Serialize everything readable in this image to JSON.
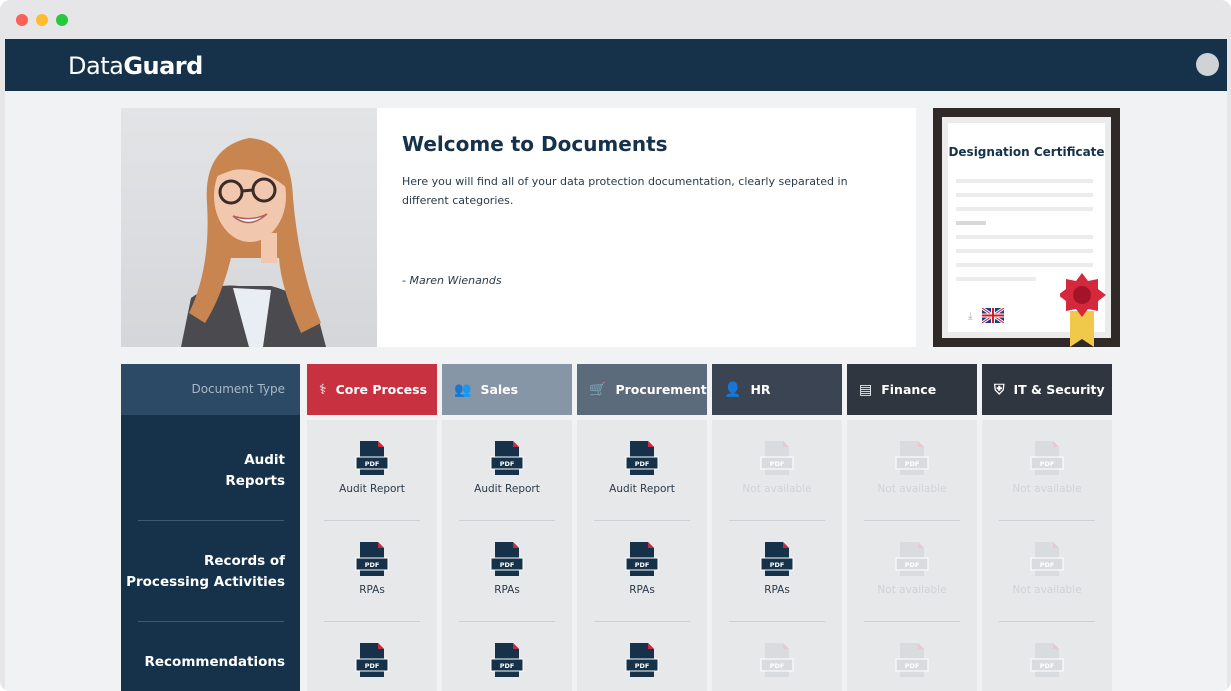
{
  "app": {
    "logo_light": "Data",
    "logo_bold": "Guard"
  },
  "hero": {
    "title": "Welcome to Documents",
    "description": "Here you will find all of your data protection documentation, clearly separated in different categories.",
    "signature": "- Maren Wienands"
  },
  "certificate": {
    "title": "Designation Certificate",
    "download_icon": "⤓"
  },
  "table": {
    "type_header": "Document Type",
    "columns": [
      {
        "label": "Core Process",
        "icon": "stethoscope-icon",
        "glyph": "⚕",
        "color": "#c8313f"
      },
      {
        "label": "Sales",
        "icon": "people-icon",
        "glyph": "👥",
        "color": "#8796a6"
      },
      {
        "label": "Procurement",
        "icon": "cart-icon",
        "glyph": "🛒",
        "color": "#5b6b7b"
      },
      {
        "label": "HR",
        "icon": "users-icon",
        "glyph": "👤",
        "color": "#3a4452"
      },
      {
        "label": "Finance",
        "icon": "finance-icon",
        "glyph": "▤",
        "color": "#2f3640"
      },
      {
        "label": "IT & Security",
        "icon": "shield-icon",
        "glyph": "⛨",
        "color": "#2f3640"
      }
    ],
    "rows": [
      {
        "label_line1": "Audit",
        "label_line2": "Reports",
        "cells": [
          "Audit Report",
          "Audit Report",
          "Audit Report",
          "Not available",
          "Not available",
          "Not available"
        ],
        "available": [
          true,
          true,
          true,
          false,
          false,
          false
        ]
      },
      {
        "label_line1": "Records of",
        "label_line2": "Processing Activities",
        "cells": [
          "RPAs",
          "RPAs",
          "RPAs",
          "RPAs",
          "Not available",
          "Not available"
        ],
        "available": [
          true,
          true,
          true,
          true,
          false,
          false
        ]
      },
      {
        "label_line1": "Recommendations",
        "label_line2": "",
        "cells": [
          "",
          "",
          "",
          "",
          "",
          ""
        ],
        "available": [
          true,
          true,
          true,
          false,
          false,
          false
        ]
      }
    ],
    "pdf_badge": "PDF"
  },
  "colors": {
    "navy": "#15324a",
    "pdf_red": "#d0283a",
    "unavailable": "#d9dcdf"
  }
}
